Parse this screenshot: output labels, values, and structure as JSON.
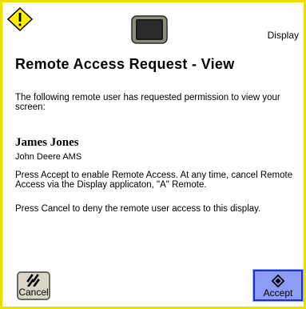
{
  "header": {
    "warning_icon": "warning-icon",
    "display_icon": "display-terminal-icon",
    "label": "Display"
  },
  "dialog": {
    "title": "Remote Access Request - View",
    "intro": "The following remote user has requested permission to view your screen:",
    "user_name": "James Jones",
    "user_org": "John Deere AMS",
    "accept_text": "Press Accept to enable Remote Access.  At any time, cancel Remote Access via the Display applicaton, \"A\" Remote.",
    "cancel_text": "Press Cancel to deny the remote user access to this display."
  },
  "buttons": {
    "cancel_label": "Cancel",
    "cancel_icon": "cancel-icon",
    "accept_label": "Accept",
    "accept_icon": "accept-icon"
  },
  "colors": {
    "frame_border": "#e8e100",
    "warning_fill": "#ffee00",
    "accept_bg": "#8c9cf5",
    "accept_border": "#1e2fd0",
    "cancel_bg": "#d9d6c8"
  }
}
